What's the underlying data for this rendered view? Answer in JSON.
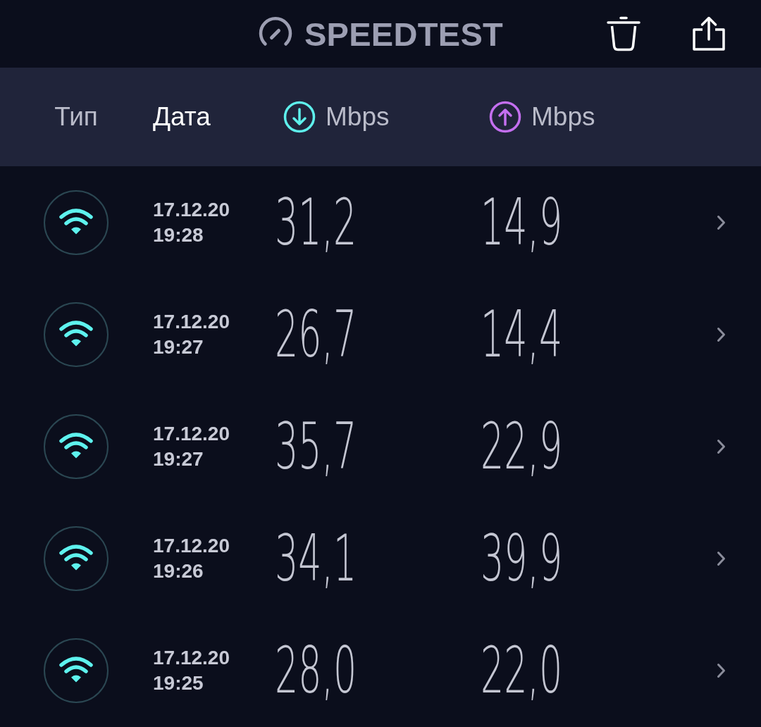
{
  "header": {
    "title": "SPEEDTEST"
  },
  "columns": [
    {
      "kind": "type",
      "label": "Тип",
      "selected": false
    },
    {
      "kind": "date",
      "label": "Дата",
      "selected": true
    },
    {
      "kind": "download",
      "label": "Mbps",
      "selected": false
    },
    {
      "kind": "upload",
      "label": "Mbps",
      "selected": false
    }
  ],
  "results": [
    {
      "kind": "wifi",
      "date": "17.12.20",
      "time": "19:28",
      "download": "31,2",
      "upload": "14,9"
    },
    {
      "kind": "wifi",
      "date": "17.12.20",
      "time": "19:27",
      "download": "26,7",
      "upload": "14,4"
    },
    {
      "kind": "wifi",
      "date": "17.12.20",
      "time": "19:27",
      "download": "35,7",
      "upload": "22,9"
    },
    {
      "kind": "wifi",
      "date": "17.12.20",
      "time": "19:26",
      "download": "34,1",
      "upload": "39,9"
    },
    {
      "kind": "wifi",
      "date": "17.12.20",
      "time": "19:25",
      "download": "28,0",
      "upload": "22,0"
    }
  ]
}
